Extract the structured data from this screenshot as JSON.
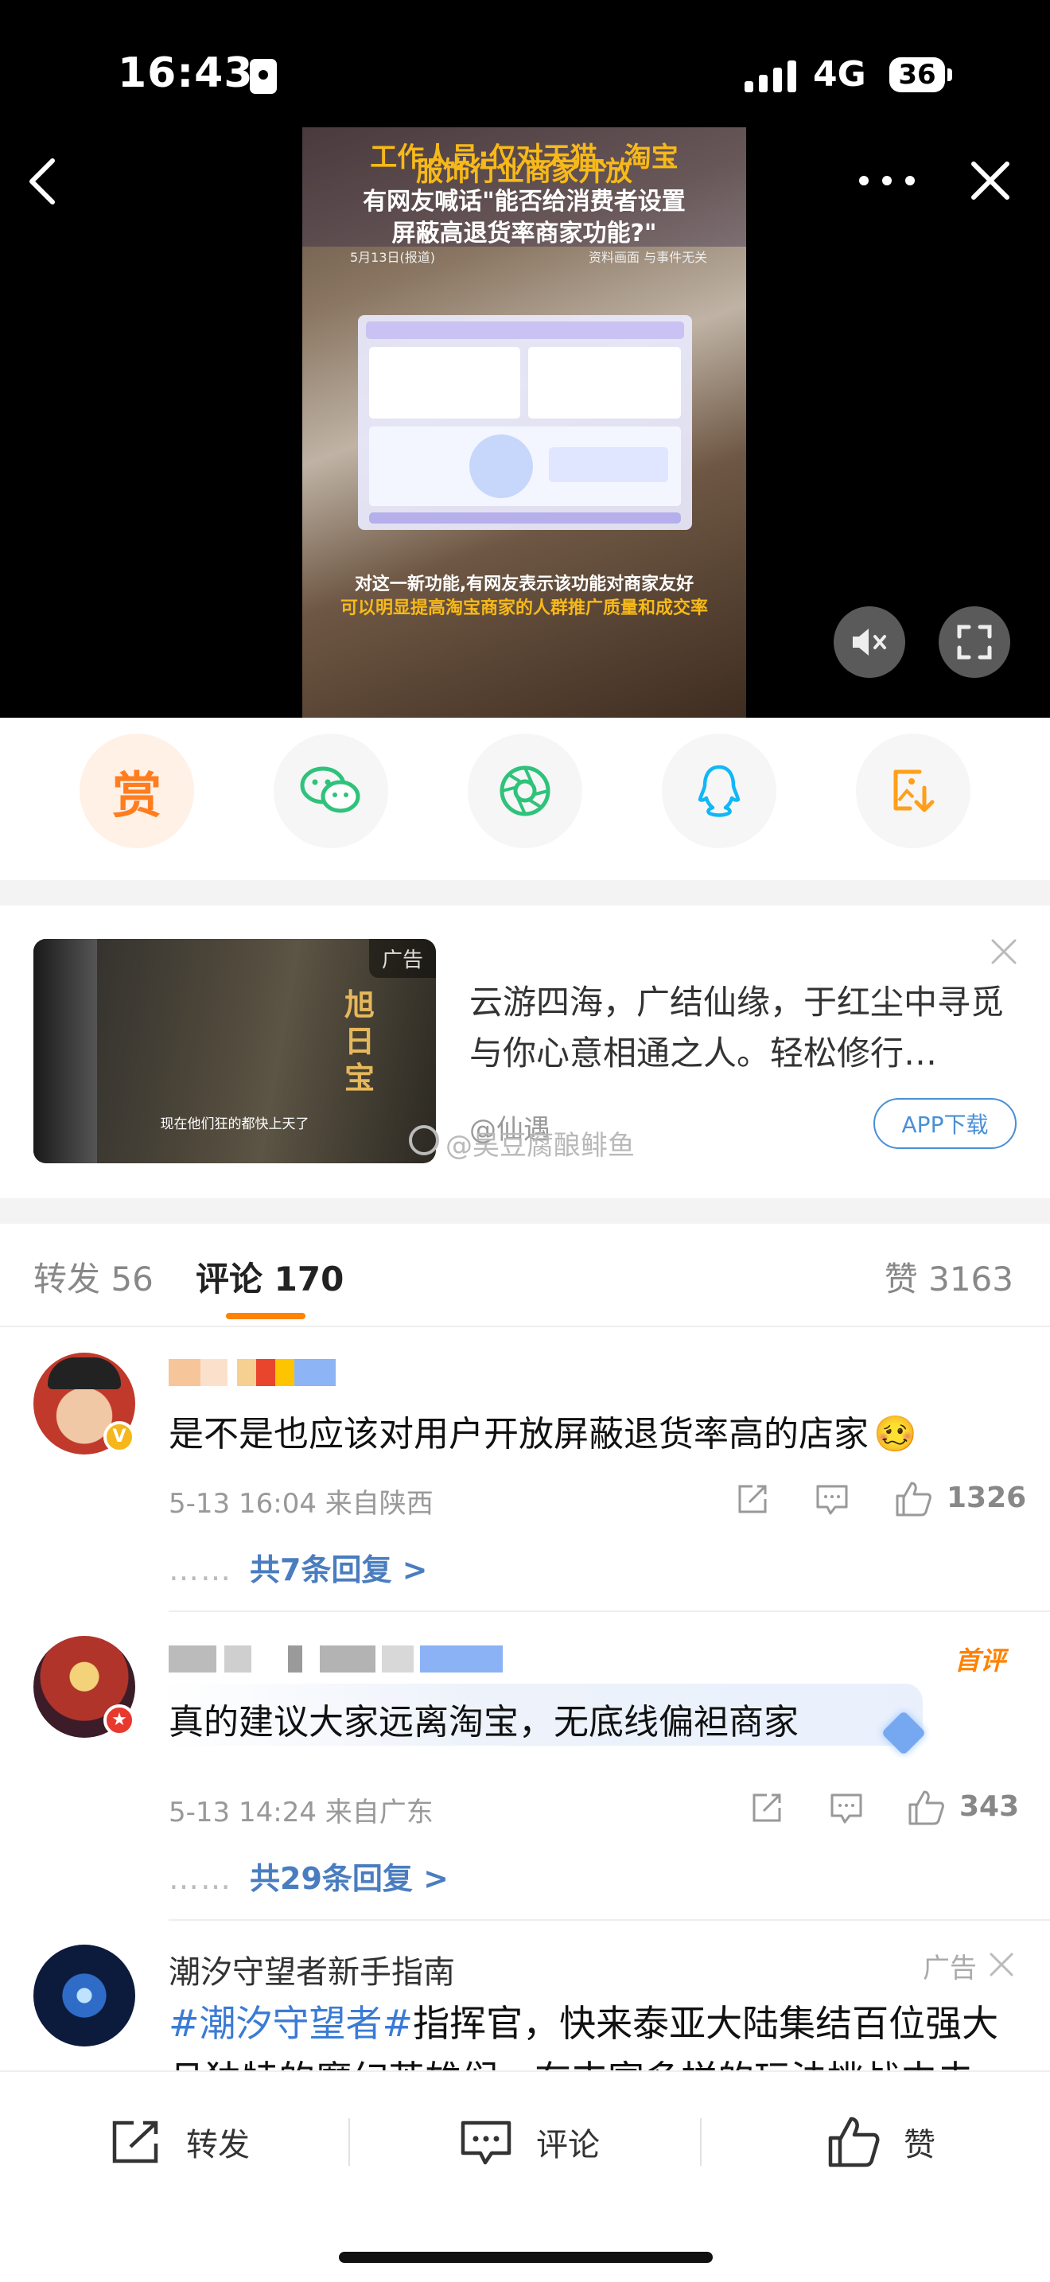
{
  "status_bar": {
    "time": "16:43",
    "network": "4G",
    "battery": "36"
  },
  "video": {
    "headline_top": "工作人员:仅对天猫、淘宝",
    "headline_1": "服饰行业商家开放",
    "headline_2": "有网友喊话\"能否给消费者设置",
    "headline_3": "屏蔽高退货率商家功能?\"",
    "date": "5月13日(报道)",
    "source": "资料画面 与事件无关",
    "caption_1": "对这一新功能,有网友表示该功能对商家友好",
    "caption_2": "可以明显提高淘宝商家的人群推广质量和成交率"
  },
  "share": {
    "reward_label": "赏",
    "icons": [
      "wechat-icon",
      "moments-icon",
      "qq-icon",
      "save-image-icon"
    ]
  },
  "ad": {
    "tag": "广告",
    "thumb_subtitle": "现在他们狂的都快上天了",
    "thumb_logo": "旭日宝",
    "text": "云游四海，广结仙缘，于红尘中寻觅与你心意相通之人。轻松修行…",
    "source": "@仙遇",
    "watermark": "@吴豆腐酿鲱鱼",
    "download_label": "APP下载"
  },
  "tabs": {
    "repost": "转发 56",
    "comment": "评论 170",
    "like": "赞 3163"
  },
  "comments": [
    {
      "text": "是不是也应该对用户开放屏蔽退货率高的店家",
      "emoji": "🥴",
      "meta": "5-13 16:04  来自陕西",
      "likes": "1326",
      "replies": "共7条回复 >",
      "dots": "……"
    },
    {
      "text": "真的建议大家远离淘宝，无底线偏袒商家",
      "meta": "5-13 14:24  来自广东",
      "likes": "343",
      "replies": "共29条回复 >",
      "dots": "……",
      "first_label": "首评"
    }
  ],
  "ad_comment": {
    "name": "潮汐守望者新手指南",
    "tag": "广告",
    "topic": "#潮汐守望者#",
    "text": "指挥官，快来泰亚大陆集结百位强大且独特的魔幻英雄们，在丰富多样的玩法挑战中去"
  },
  "bottom_bar": {
    "repost": "转发",
    "comment": "评论",
    "like": "赞"
  },
  "colors": {
    "accent": "#ff8200",
    "link": "#4a7dbf",
    "topic": "#3a7bd5"
  }
}
